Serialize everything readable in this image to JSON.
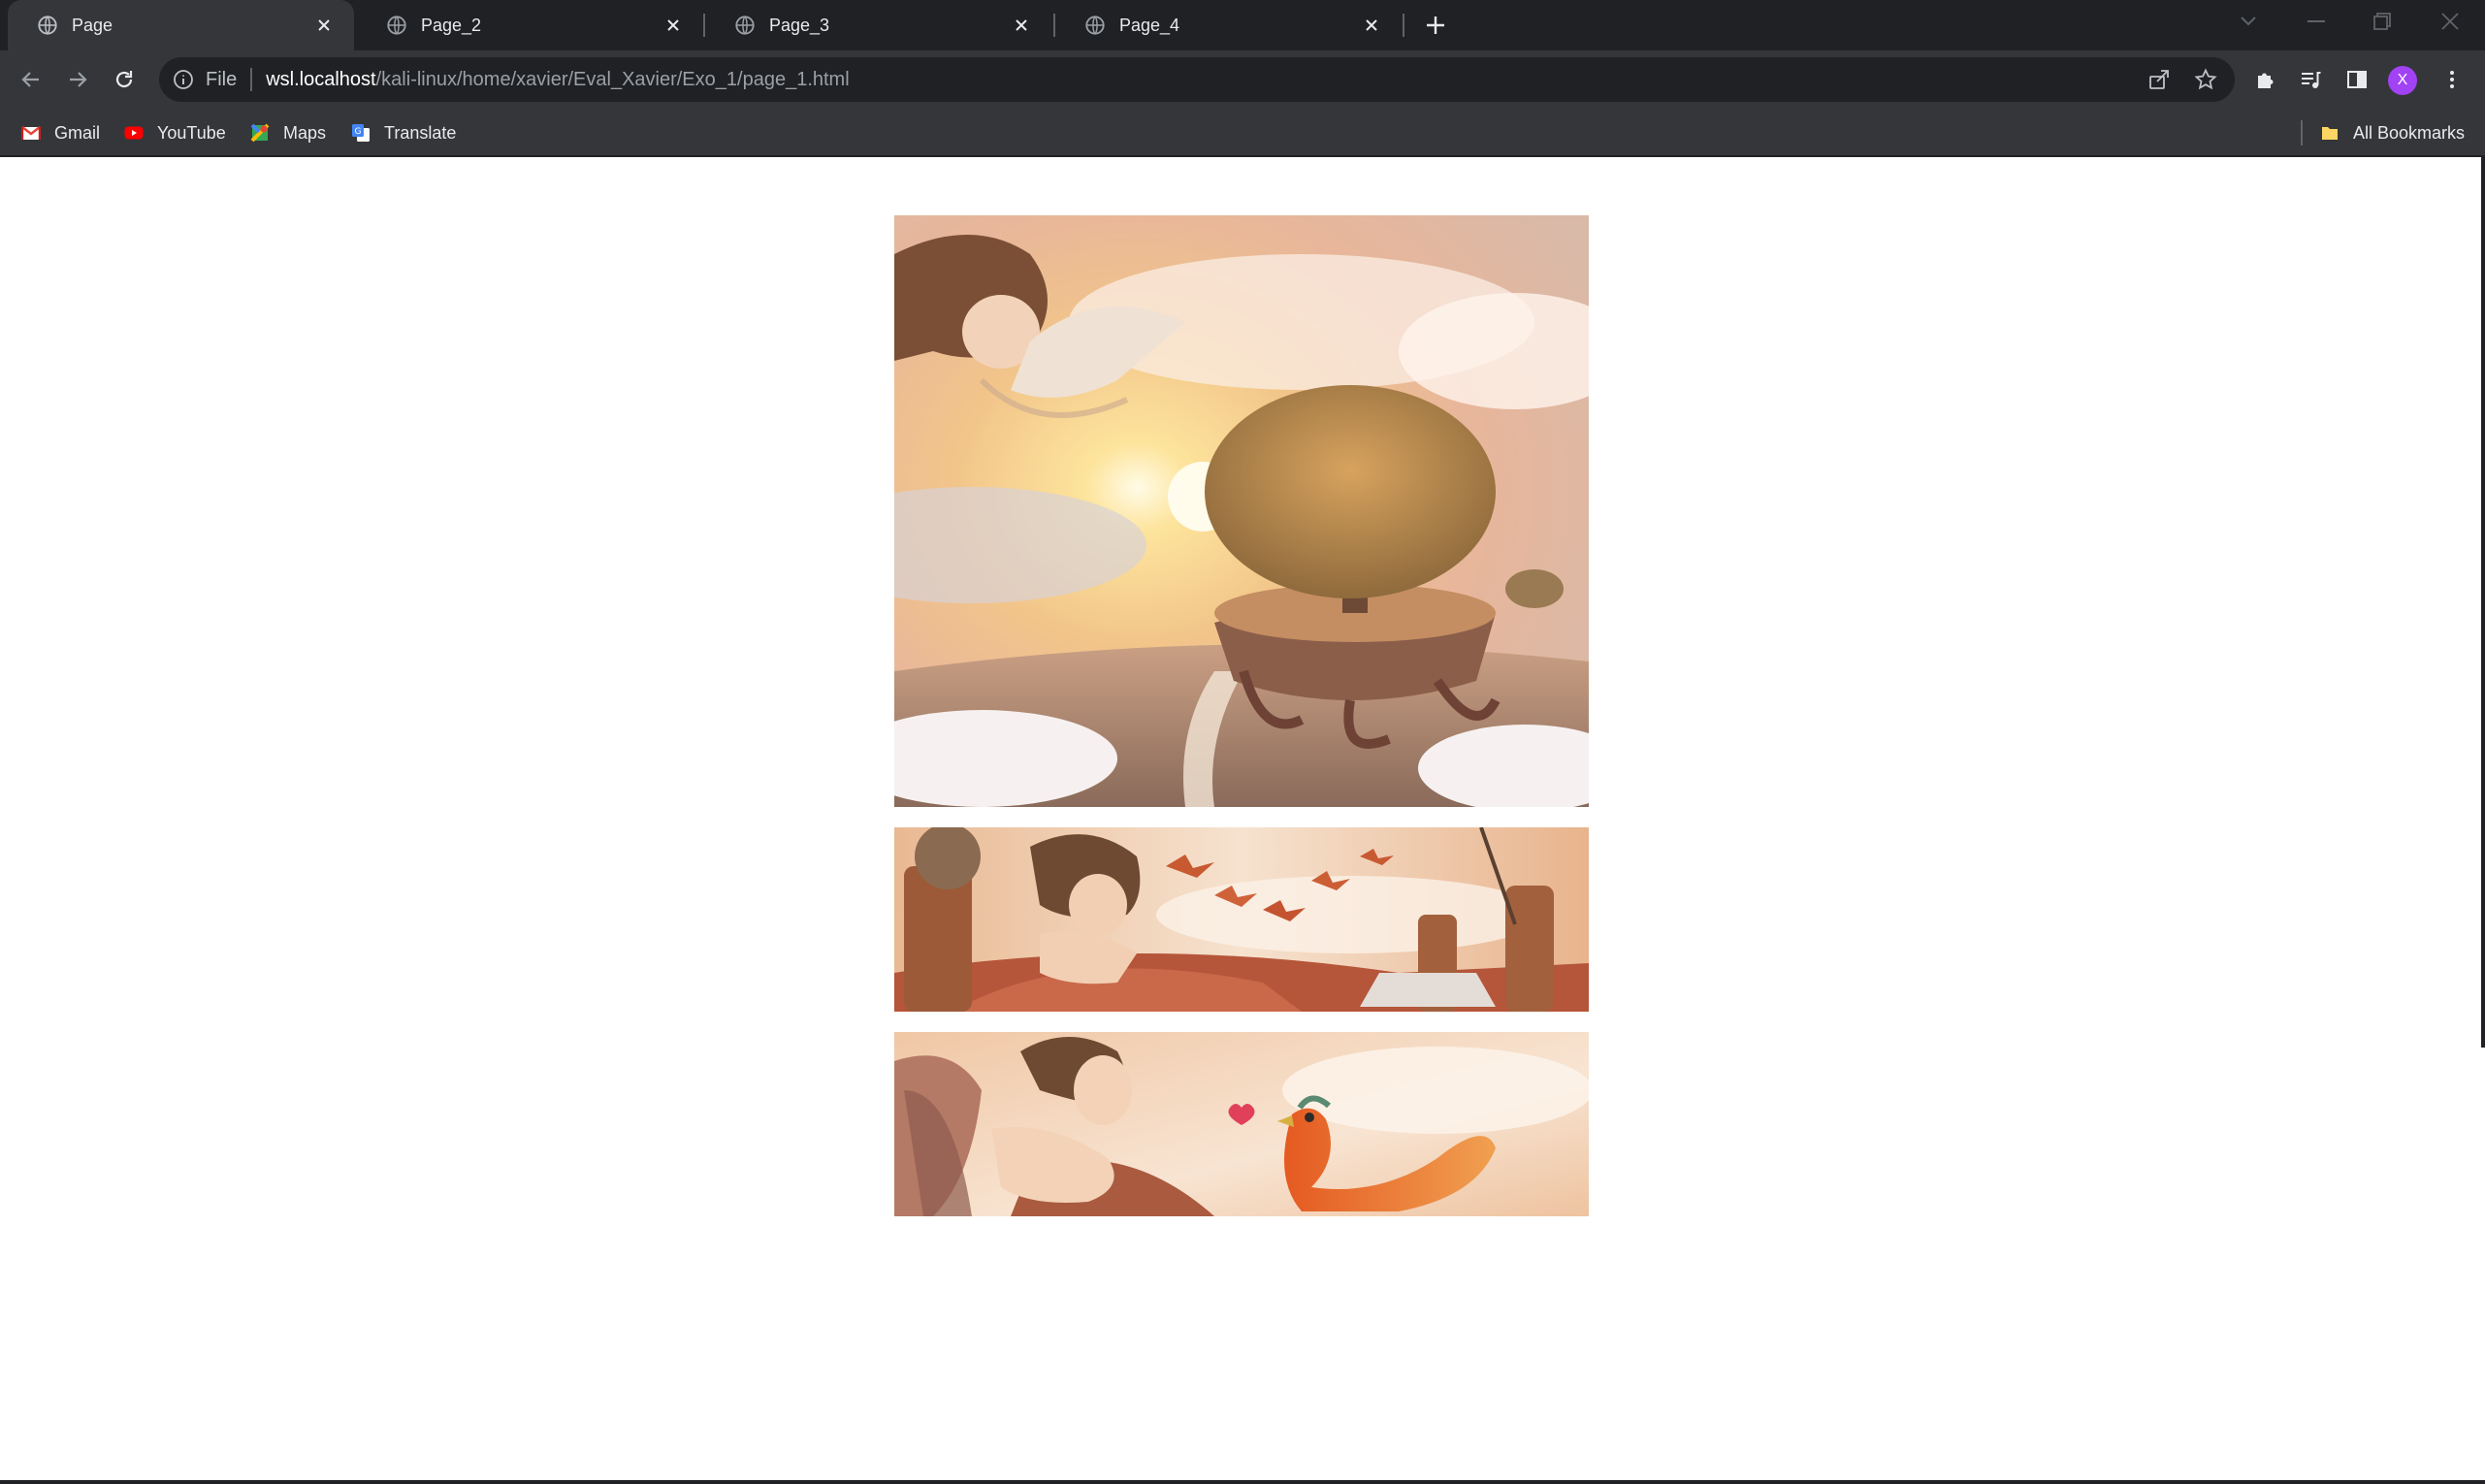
{
  "browser": {
    "tabs": [
      {
        "title": "Page",
        "active": true
      },
      {
        "title": "Page_2",
        "active": false
      },
      {
        "title": "Page_3",
        "active": false
      },
      {
        "title": "Page_4",
        "active": false
      }
    ],
    "address": {
      "scheme_label": "File",
      "host": "wsl.localhost",
      "path": "/kali-linux/home/xavier/Eval_Xavier/Exo_1/page_1.html"
    },
    "profile_initial": "X",
    "bookmarks": [
      {
        "label": "Gmail",
        "icon": "gmail-icon"
      },
      {
        "label": "YouTube",
        "icon": "youtube-icon"
      },
      {
        "label": "Maps",
        "icon": "maps-icon"
      },
      {
        "label": "Translate",
        "icon": "translate-icon"
      }
    ],
    "all_bookmarks_label": "All Bookmarks"
  },
  "page": {
    "panels": [
      {
        "name": "sky-island-tree-illustration"
      },
      {
        "name": "girl-on-flying-bed-illustration"
      },
      {
        "name": "girl-and-bird-illustration"
      }
    ]
  },
  "colors": {
    "tab_bar": "#202124",
    "toolbar": "#35363a",
    "avatar": "#a142f4",
    "illustration_warm": "#e8a56a"
  }
}
